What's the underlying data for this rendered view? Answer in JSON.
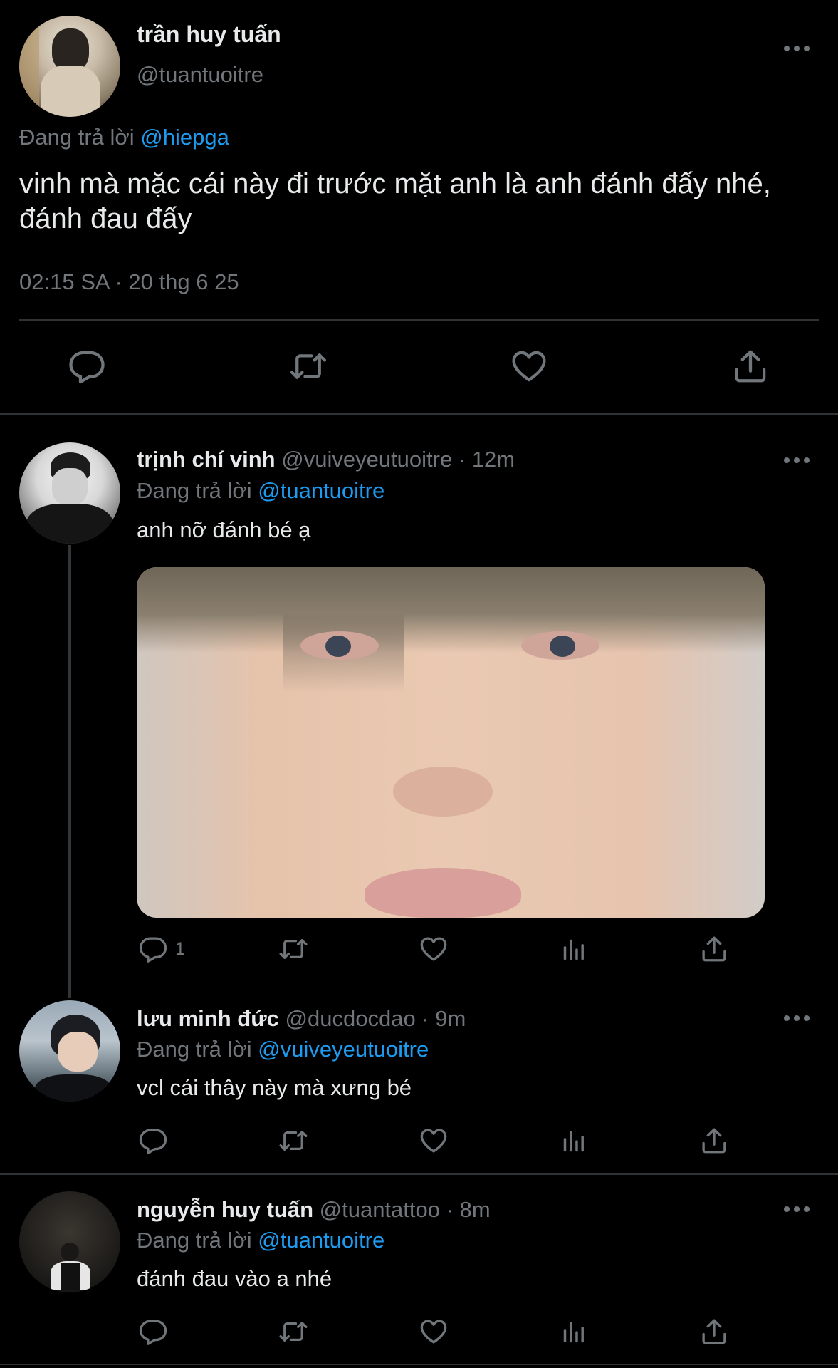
{
  "main_tweet": {
    "display_name": "trần huy tuấn",
    "handle": "@tuantuoitre",
    "replying_label": "Đang trả lời",
    "replying_to": "@hiepga",
    "text_line1": "vinh mà mặc cái này đi trước mặt anh là anh đánh đấy nhé,",
    "text_line2": "đánh đau đấy",
    "time": "02:15 SA",
    "date": "20 thg 6 25"
  },
  "replies": [
    {
      "display_name": "trịnh chí vinh",
      "handle": "@vuiveyeutuoitre",
      "time": "12m",
      "replying_label": "Đang trả lời",
      "replying_to": "@tuantuoitre",
      "text": "anh nỡ đánh bé ạ",
      "reply_count": "1"
    },
    {
      "display_name": "lưu minh đức",
      "handle": "@ducdocdao",
      "time": "9m",
      "replying_label": "Đang trả lời",
      "replying_to": "@vuiveyeutuoitre",
      "text": "vcl cái thây này mà xưng bé"
    },
    {
      "display_name": "nguyễn huy tuấn",
      "handle": "@tuantattoo",
      "time": "8m",
      "replying_label": "Đang trả lời",
      "replying_to": "@tuantuoitre",
      "text": "đánh đau vào a nhé"
    }
  ],
  "separator": "·",
  "icons": {
    "reply": "reply-icon",
    "retweet": "retweet-icon",
    "like": "heart-icon",
    "views": "views-icon",
    "share": "share-icon",
    "more": "more-icon"
  },
  "colors": {
    "background": "#000000",
    "text": "#e7e9ea",
    "secondary": "#71767b",
    "link": "#1d9bf0",
    "divider": "#2f3336"
  }
}
